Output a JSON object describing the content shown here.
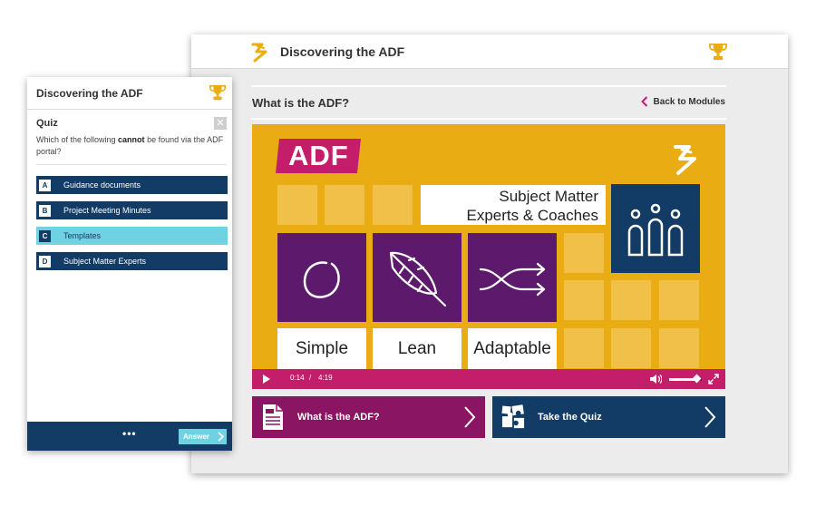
{
  "main": {
    "title": "Discovering the ADF",
    "section_title": "What is the ADF?",
    "back_label": "Back to Modules",
    "video": {
      "badge": "ADF",
      "sme_line1": "Subject Matter",
      "sme_line2": "Experts & Coaches",
      "words": [
        "Simple",
        "Lean",
        "Adaptable"
      ],
      "current_time": "0:14",
      "separator": "/",
      "duration": "4:19",
      "volume": 0.85
    },
    "buttons": {
      "what": "What is the ADF?",
      "quiz": "Take the Quiz"
    }
  },
  "quiz_panel": {
    "title": "Discovering the ADF",
    "heading": "Quiz",
    "question_before": "Which of the following ",
    "question_bold": "cannot",
    "question_after": " be found via the ADF portal?",
    "options": [
      {
        "key": "A",
        "label": "Guidance documents"
      },
      {
        "key": "B",
        "label": "Project Meeting Minutes"
      },
      {
        "key": "C",
        "label": "Templates"
      },
      {
        "key": "D",
        "label": "Subject Matter Experts"
      }
    ],
    "selected_key": "C",
    "more_label": "•••",
    "answer_label": "Answer",
    "close_label": "✕"
  },
  "colors": {
    "navy": "#123c66",
    "magenta": "#c41e6b",
    "plum": "#8a1563",
    "gold": "#e9ad13",
    "purple": "#5d1a6d",
    "cyan": "#6fd2e3"
  }
}
